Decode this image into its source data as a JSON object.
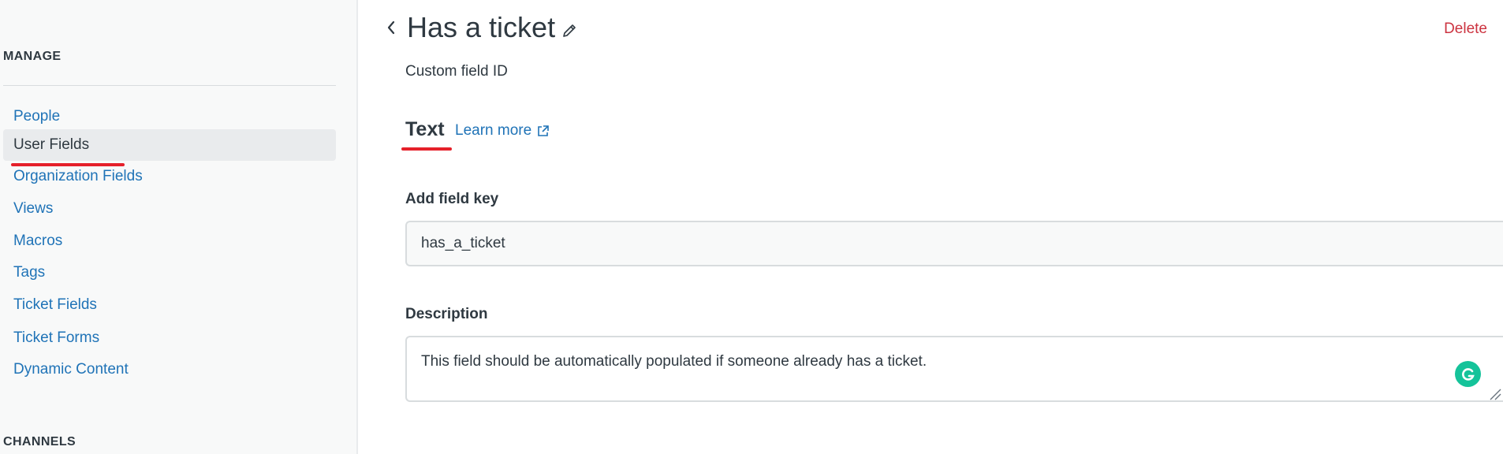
{
  "sidebar": {
    "manage_title": "MANAGE",
    "items": [
      {
        "label": "People",
        "active": false
      },
      {
        "label": "User Fields",
        "active": true
      },
      {
        "label": "Organization Fields",
        "active": false
      },
      {
        "label": "Views",
        "active": false
      },
      {
        "label": "Macros",
        "active": false
      },
      {
        "label": "Tags",
        "active": false
      },
      {
        "label": "Ticket Fields",
        "active": false
      },
      {
        "label": "Ticket Forms",
        "active": false
      },
      {
        "label": "Dynamic Content",
        "active": false
      }
    ],
    "channels_title": "CHANNELS"
  },
  "header": {
    "title": "Has a ticket",
    "delete_label": "Delete",
    "subtitle": "Custom field ID"
  },
  "field_type": {
    "label": "Text",
    "learn_more": "Learn more"
  },
  "field_key": {
    "label": "Add field key",
    "value": "has_a_ticket"
  },
  "description": {
    "label": "Description",
    "value": "This field should be automatically populated if someone already has a ticket."
  },
  "colors": {
    "link": "#1f73b7",
    "danger": "#cc3340",
    "annotation": "#e5202a",
    "grammarly": "#15c39a"
  },
  "icons": {
    "back": "chevron-left-icon",
    "edit": "pencil-icon",
    "external": "external-link-icon",
    "grammarly": "grammarly-icon"
  }
}
